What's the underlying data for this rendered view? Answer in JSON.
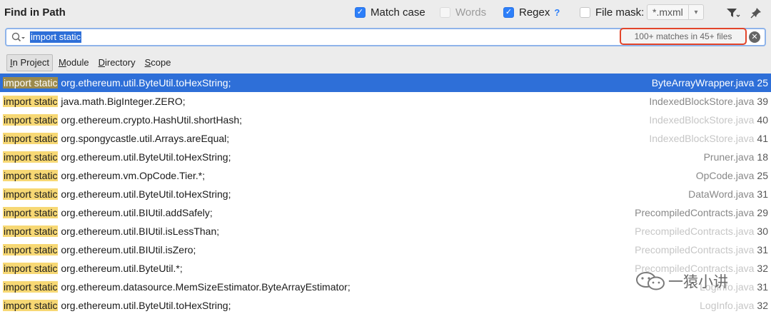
{
  "header": {
    "title": "Find in Path",
    "match_case": {
      "label": "Match case",
      "checked": true
    },
    "words": {
      "label": "Words",
      "checked": false,
      "enabled": false
    },
    "regex": {
      "label": "Regex",
      "checked": true,
      "help": "?"
    },
    "file_mask": {
      "label": "File mask:",
      "checked": false,
      "value": "*.mxml"
    }
  },
  "search": {
    "query": "import static",
    "match_count": "100+ matches in 45+ files"
  },
  "scopes": [
    {
      "label": "In Project",
      "mnemonic": "I",
      "rest": "n Project",
      "active": true
    },
    {
      "label": "Module",
      "mnemonic": "M",
      "rest": "odule",
      "active": false
    },
    {
      "label": "Directory",
      "mnemonic": "D",
      "rest": "irectory",
      "active": false
    },
    {
      "label": "Scope",
      "mnemonic": "S",
      "rest": "cope",
      "active": false
    }
  ],
  "results": [
    {
      "match": "import static",
      "rest": " org.ethereum.util.ByteUtil.toHexString;",
      "file": "ByteArrayWrapper.java",
      "line": "25",
      "selected": true,
      "faded": false
    },
    {
      "match": "import static",
      "rest": " java.math.BigInteger.ZERO;",
      "file": "IndexedBlockStore.java",
      "line": "39",
      "selected": false,
      "faded": false
    },
    {
      "match": "import static",
      "rest": " org.ethereum.crypto.HashUtil.shortHash;",
      "file": "IndexedBlockStore.java",
      "line": "40",
      "selected": false,
      "faded": true
    },
    {
      "match": "import static",
      "rest": " org.spongycastle.util.Arrays.areEqual;",
      "file": "IndexedBlockStore.java",
      "line": "41",
      "selected": false,
      "faded": true
    },
    {
      "match": "import static",
      "rest": " org.ethereum.util.ByteUtil.toHexString;",
      "file": "Pruner.java",
      "line": "18",
      "selected": false,
      "faded": false
    },
    {
      "match": "import static",
      "rest": " org.ethereum.vm.OpCode.Tier.*;",
      "file": "OpCode.java",
      "line": "25",
      "selected": false,
      "faded": false
    },
    {
      "match": "import static",
      "rest": " org.ethereum.util.ByteUtil.toHexString;",
      "file": "DataWord.java",
      "line": "31",
      "selected": false,
      "faded": false
    },
    {
      "match": "import static",
      "rest": " org.ethereum.util.BIUtil.addSafely;",
      "file": "PrecompiledContracts.java",
      "line": "29",
      "selected": false,
      "faded": false
    },
    {
      "match": "import static",
      "rest": " org.ethereum.util.BIUtil.isLessThan;",
      "file": "PrecompiledContracts.java",
      "line": "30",
      "selected": false,
      "faded": true
    },
    {
      "match": "import static",
      "rest": " org.ethereum.util.BIUtil.isZero;",
      "file": "PrecompiledContracts.java",
      "line": "31",
      "selected": false,
      "faded": true
    },
    {
      "match": "import static",
      "rest": " org.ethereum.util.ByteUtil.*;",
      "file": "PrecompiledContracts.java",
      "line": "32",
      "selected": false,
      "faded": true
    },
    {
      "match": "import static",
      "rest": " org.ethereum.datasource.MemSizeEstimator.ByteArrayEstimator;",
      "file": "LogInfo.java",
      "line": "31",
      "selected": false,
      "faded": true
    },
    {
      "match": "import static",
      "rest": " org.ethereum.util.ByteUtil.toHexString;",
      "file": "LogInfo.java",
      "line": "32",
      "selected": false,
      "faded": true
    }
  ],
  "watermark": {
    "text": "一猿小讲"
  },
  "colors": {
    "accent": "#2e6fd8",
    "highlight": "#f7d874",
    "count_border": "#e2452a"
  }
}
